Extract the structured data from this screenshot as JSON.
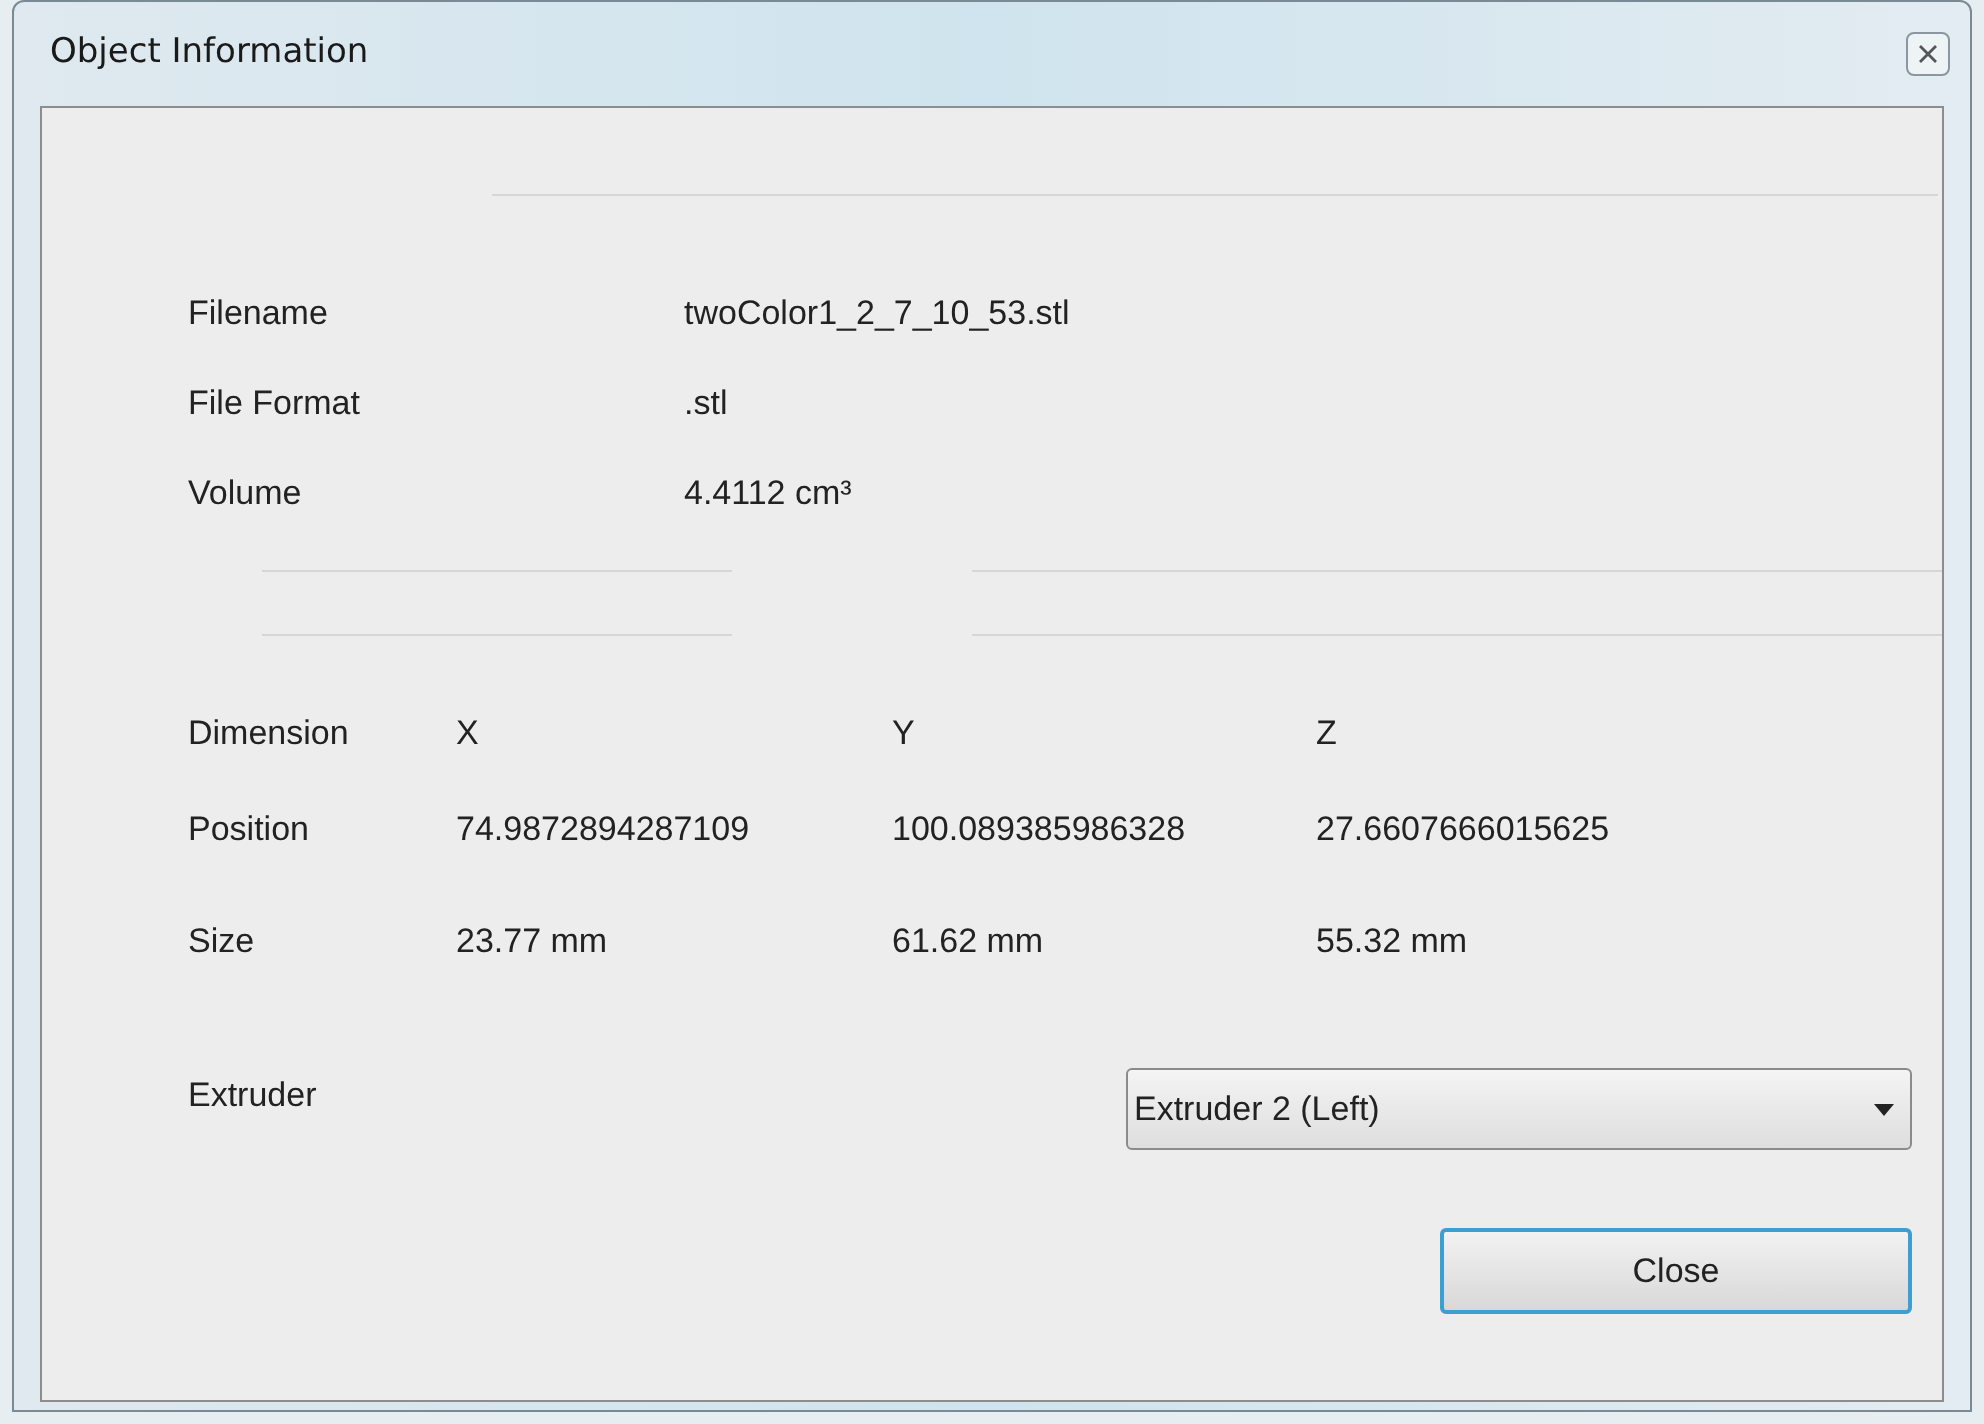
{
  "window": {
    "title": "Object Information"
  },
  "file_info": [
    {
      "label": "Filename",
      "value": "twoColor1_2_7_10_53.stl"
    },
    {
      "label": "File Format",
      "value": ".stl"
    },
    {
      "label": "Volume",
      "value": "4.4112 cm³"
    }
  ],
  "dimensions": {
    "header": [
      "Dimension",
      "X",
      "Y",
      "Z"
    ],
    "rows": [
      [
        "Position",
        "74.9872894287109",
        "100.089385986328",
        "27.6607666015625"
      ],
      [
        "Size",
        "23.77 mm",
        "61.62 mm",
        "55.32 mm"
      ]
    ]
  },
  "extruder": {
    "label": "Extruder",
    "value": "Extruder 2 (Left)"
  },
  "buttons": [
    {
      "label": "Close",
      "focused": true
    }
  ]
}
